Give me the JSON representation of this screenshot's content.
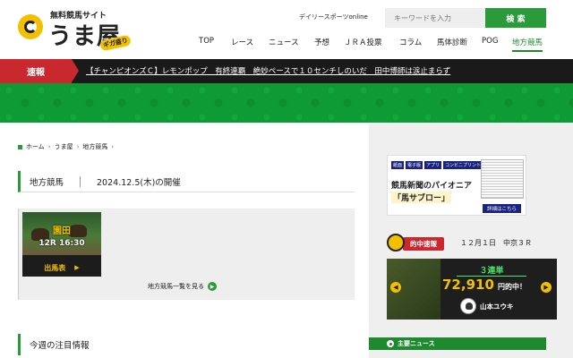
{
  "header": {
    "logo_sub": "無料競馬サイト",
    "logo_main": "うま屋",
    "logo_badge": "ギガ盛り",
    "partner_link": "デイリースポーツonline",
    "search_placeholder": "キーワードを入力",
    "search_button": "検 索"
  },
  "nav": [
    "TOP",
    "レース",
    "ニュース",
    "予想",
    "ＪＲＡ投票",
    "コラム",
    "馬体診断",
    "POG",
    "地方競馬"
  ],
  "nav_active": "地方競馬",
  "breaking": {
    "label": "速報",
    "text": "【チャンピオンズＣ】レモンポップ　有終連覇　絶妙ペースで１０センチしのいだ　田中博師は涙止まらず"
  },
  "breadcrumb": [
    "ホーム",
    "うま屋",
    "地方競馬"
  ],
  "section1": {
    "title": "地方競馬",
    "date": "2024.12.5(木)の開催"
  },
  "race_card": {
    "venue": "園田",
    "race": "12R 16:30",
    "entries_label": "出馬表"
  },
  "list_link": "地方競馬一覧を見る",
  "section2_title": "今週の注目情報",
  "ad": {
    "tags": [
      "紙面",
      "電子版",
      "アプリ",
      "コンビニプリント"
    ],
    "title": "競馬新聞のパイオニア",
    "subtitle": "「馬サブロー」",
    "detail": "詳細はこちら"
  },
  "hit": {
    "label": "的中速報",
    "date": "１２月１日　中京３Ｒ",
    "bet_type": "３連単",
    "payout": "72,910",
    "unit": "円的中！",
    "name": "山本ユウキ"
  },
  "news": {
    "label": "主要ニュース"
  },
  "colors": {
    "brand_green": "#2a9a3a",
    "brand_yellow": "#f3c000",
    "breaking_red": "#c8282e"
  }
}
